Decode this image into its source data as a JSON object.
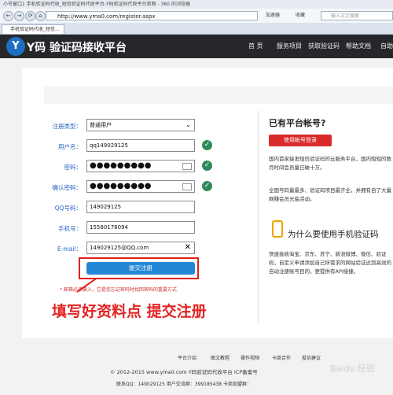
{
  "browser": {
    "title_bar": "小号窗口1 手机验证码代收_短信验证码代收平台-Y码验证码代收平台官网 - 360 的浏览器",
    "url": "http://www.yma0.com/register.aspx",
    "address_hint": "加速器",
    "favorites_label": "收藏",
    "back_label": "←",
    "forward_label": "→",
    "search_placeholder": "输入文字搜索",
    "tab_title": "手机验证码代收_短信..."
  },
  "site": {
    "logo_letter": "Y",
    "logo_text": "Y码 验证码接收平台",
    "nav": [
      "首 页",
      "服务项目",
      "获取验证码",
      "帮助文档",
      "自助"
    ]
  },
  "form": {
    "fields": [
      {
        "label": "注册类型：",
        "value": "普通用户",
        "type": "select"
      },
      {
        "label": "用户名：",
        "value": "qq149029125",
        "type": "text",
        "ok": true
      },
      {
        "label": "密码：",
        "value": "●●●●●●●●●",
        "type": "password",
        "ok": true
      },
      {
        "label": "确认密码：",
        "value": "●●●●●●●●●",
        "type": "password",
        "ok": true
      },
      {
        "label": "QQ号码：",
        "value": "149029125",
        "type": "text"
      },
      {
        "label": "手机号：",
        "value": "15580178094",
        "type": "text"
      },
      {
        "label": "E-mail：",
        "value": "149029125@QQ.com",
        "type": "text",
        "clear": true
      }
    ],
    "submit_label": "提交注册",
    "note": "* 邮箱必须输入，它是您忘记密码时找回密码的重要方式",
    "annotation": "填写好资料点 提交注册"
  },
  "side": {
    "heading": "已有平台帐号?",
    "login_button": "使用帐号登录",
    "para1": "国内首家接发短信验证码的云服务平台，国内短短的数月时间会员量已破十万。",
    "para2": "全国号码量最多、验证码项目最齐全，并拥有自了大量网赚会员光临活动。",
    "why_heading": "为什么要使用手机验证码",
    "para3": "快速接收淘宝、京东、苏宁、新浪微博、微信、验证码，自定义申请添加自己所需求的网站验证达到高效的自动注册账号目的。更提供有API接捷。"
  },
  "footer": {
    "links": [
      "平台介绍",
      "图文教程",
      "操作视频",
      "卡商合作",
      "投诉建议"
    ],
    "copyright": "© 2012-2015 www.yma0.com Y码验证码代收平台 ICP备案号",
    "contact": "联系QQ：149029125 用户交流群：399185438 卡商加盟群：",
    "watermark": "Baidu 经验"
  },
  "colors": {
    "accent": "#2387d6",
    "header_bg": "#26272b",
    "red": "#d92b2b",
    "label_blue": "#2a63c6",
    "check_green": "#2e8b57"
  }
}
